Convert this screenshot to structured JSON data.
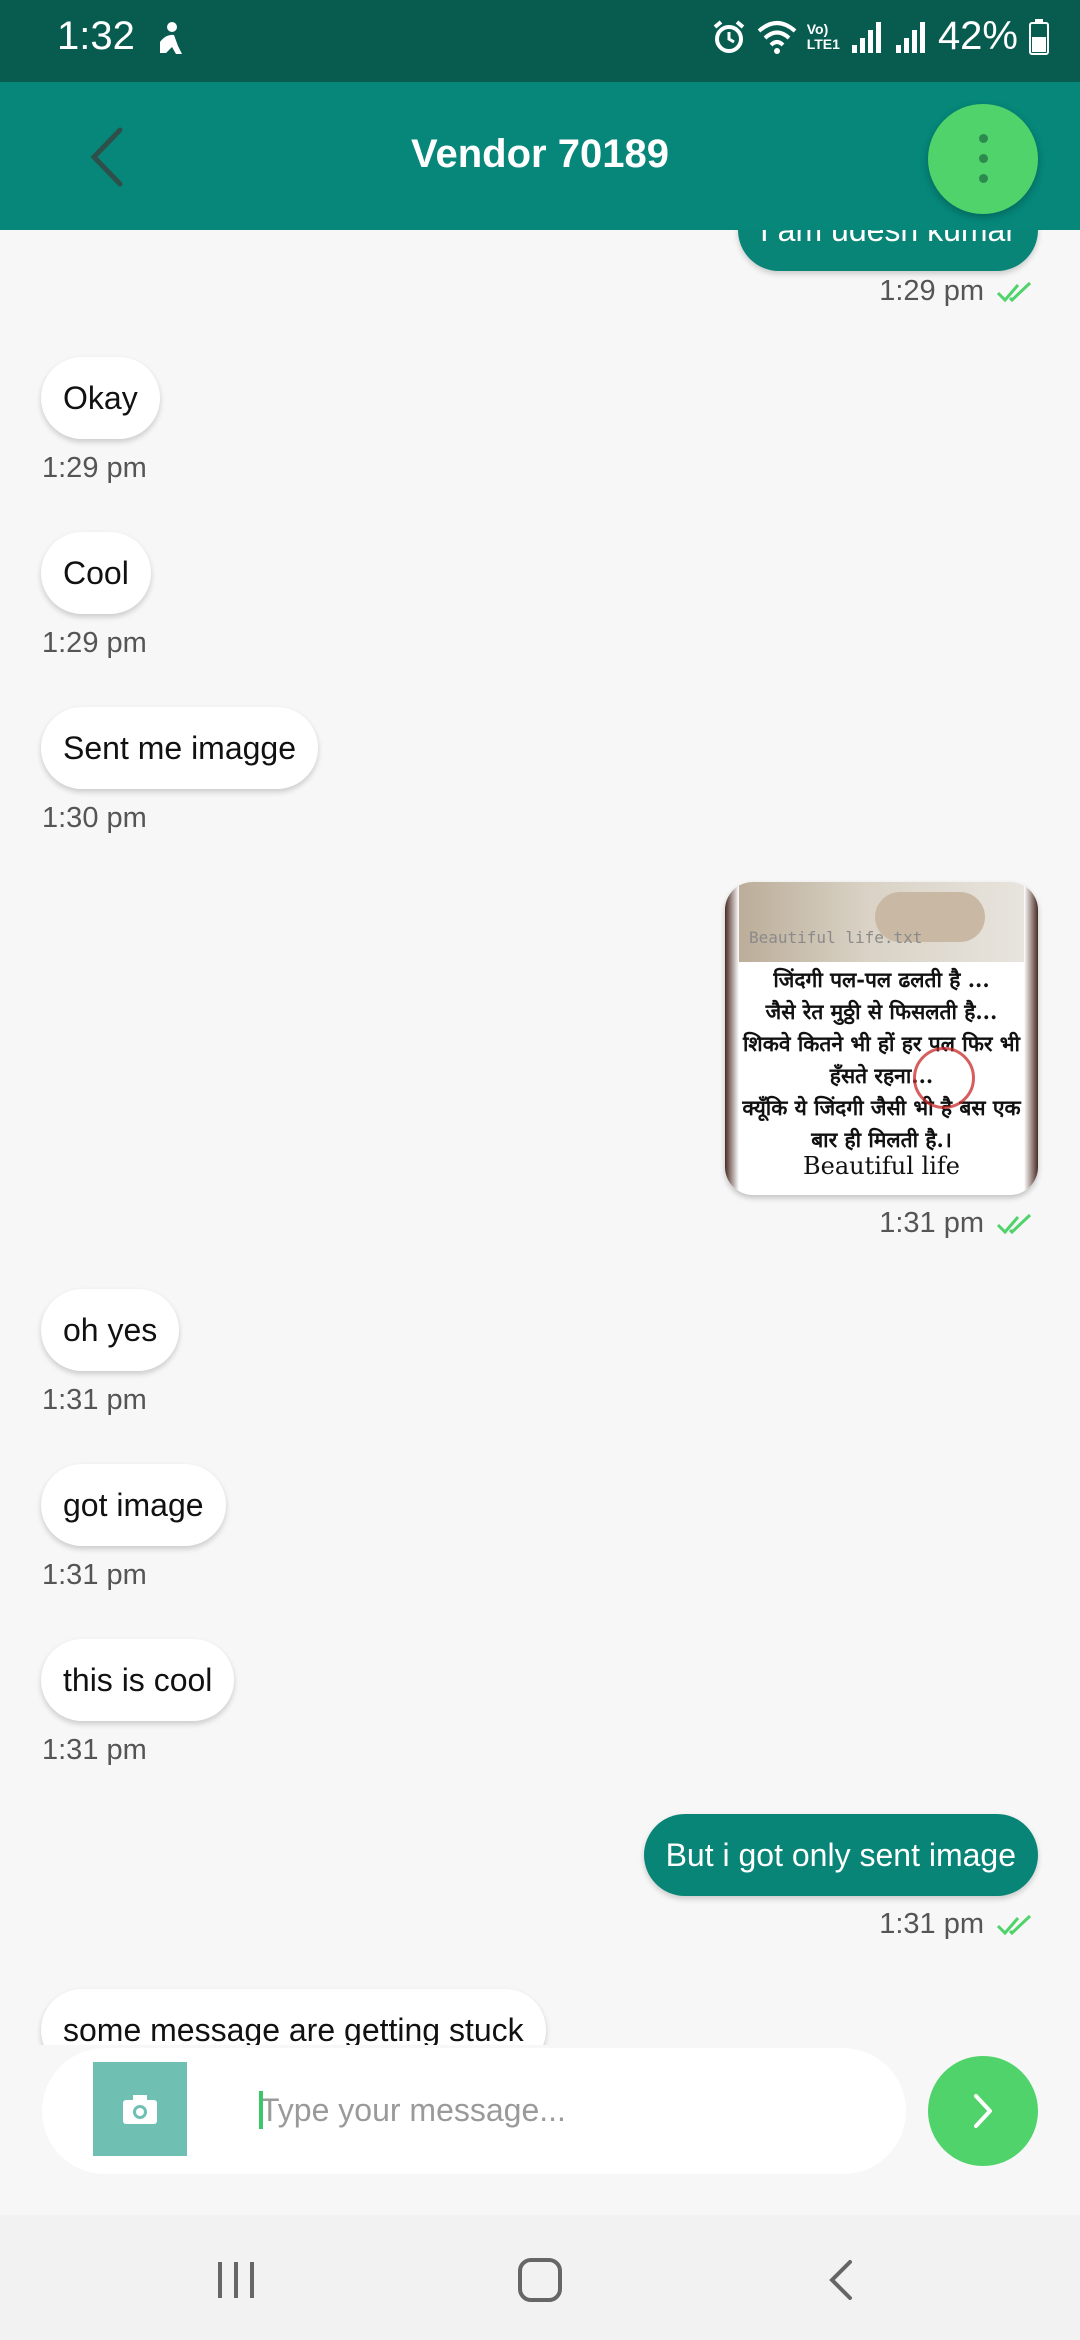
{
  "status_bar": {
    "time": "1:32",
    "network_label": "Vo)\nLTE1",
    "battery": "42%"
  },
  "header": {
    "title": "Vendor 70189"
  },
  "messages": [
    {
      "type": "text",
      "direction": "out",
      "text": "I am udesh kumar",
      "time": "1:29 pm"
    },
    {
      "type": "text",
      "direction": "in",
      "text": "Okay",
      "time": "1:29 pm"
    },
    {
      "type": "text",
      "direction": "in",
      "text": "Cool",
      "time": "1:29 pm"
    },
    {
      "type": "text",
      "direction": "in",
      "text": "Sent me imagge",
      "time": "1:30 pm"
    },
    {
      "type": "image",
      "direction": "out",
      "time": "1:31 pm",
      "image_text": {
        "watermark": "Beautiful life.txt",
        "lines": [
          "जिंदगी पल-पल ढलती है ...",
          "जैसे रेत मुठ्ठी से फिसलती है...",
          "शिकवे कितने भी हों हर पल फिर भी",
          "हँसते रहना...",
          "क्यूँकि ये जिंदगी जैसी भी है बस एक",
          "बार ही मिलती है.।"
        ],
        "caption": "Beautiful life"
      }
    },
    {
      "type": "text",
      "direction": "in",
      "text": "oh yes",
      "time": "1:31 pm"
    },
    {
      "type": "text",
      "direction": "in",
      "text": "got image",
      "time": "1:31 pm"
    },
    {
      "type": "text",
      "direction": "in",
      "text": "this is cool",
      "time": "1:31 pm"
    },
    {
      "type": "text",
      "direction": "out",
      "text": "But i got only sent image",
      "time": "1:31 pm"
    },
    {
      "type": "text",
      "direction": "in",
      "text": "some message are getting stuck",
      "time": ""
    }
  ],
  "composer": {
    "placeholder": "Type your message...",
    "value": ""
  },
  "icons": {
    "back": "chevron-left-icon",
    "menu": "more-vertical-icon",
    "camera": "camera-icon",
    "send": "chevron-right-icon",
    "read_receipt": "double-check-icon"
  },
  "colors": {
    "status_bar": "#075c4f",
    "header": "#06877a",
    "accent_green": "#4fd36a",
    "outgoing_bubble": "#088577",
    "incoming_bubble": "#ffffff",
    "background": "#f7f7f7"
  }
}
